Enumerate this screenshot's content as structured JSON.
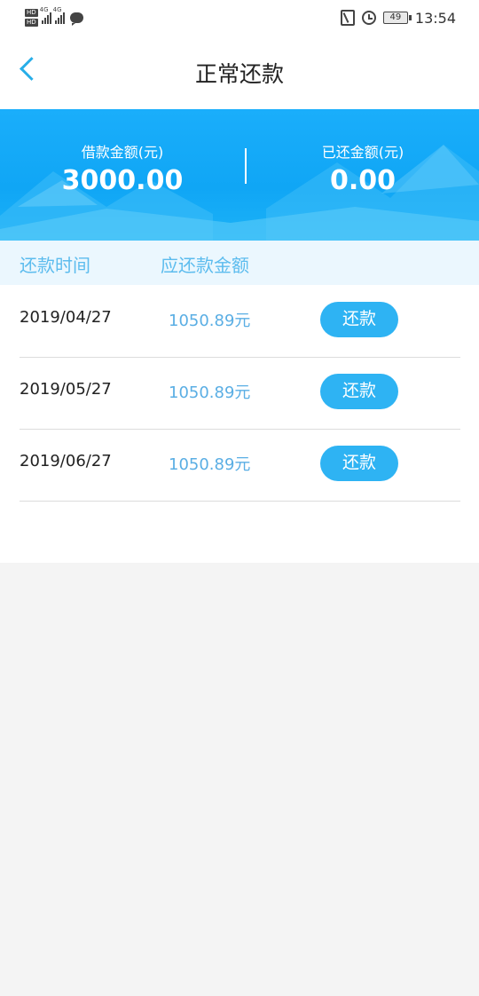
{
  "status_bar": {
    "hd1": "HD",
    "hd2": "HD",
    "net1": "4G",
    "net2": "4G",
    "battery": "49",
    "time": "13:54"
  },
  "nav": {
    "title": "正常还款"
  },
  "summary": {
    "borrow_label": "借款金额(元)",
    "borrow_value": "3000.00",
    "repaid_label": "已还金额(元)",
    "repaid_value": "0.00"
  },
  "table": {
    "headers": [
      "还款时间",
      "应还款金额"
    ],
    "rows": [
      {
        "date": "2019/04/27",
        "amount": "1050.89元",
        "action": "还款"
      },
      {
        "date": "2019/05/27",
        "amount": "1050.89元",
        "action": "还款"
      },
      {
        "date": "2019/06/27",
        "amount": "1050.89元",
        "action": "还款"
      }
    ]
  },
  "colors": {
    "accent": "#27aee8",
    "banner": "#10a6f5",
    "button": "#2eb3f3",
    "amount_text": "#5aaee4",
    "header_bg": "#ebf7fe"
  },
  "icons": [
    "back-arrow-icon",
    "message-icon",
    "nfc-icon",
    "alarm-icon",
    "battery-icon",
    "signal-icon"
  ]
}
